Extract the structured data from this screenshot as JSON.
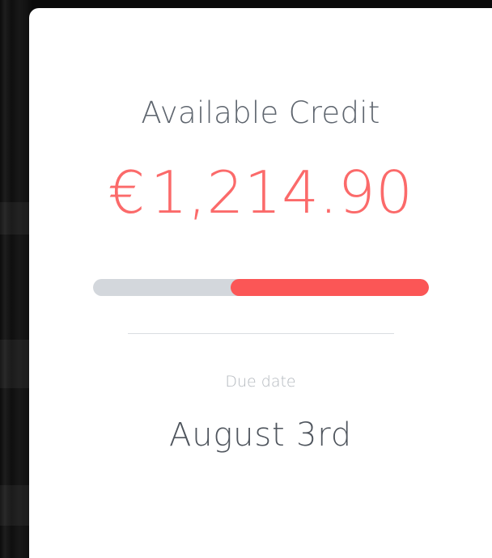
{
  "card": {
    "title": "Available Credit",
    "amount": {
      "currency_symbol": "€",
      "value": "1,214.90"
    },
    "progress": {
      "used_fraction": 0.59,
      "track_color": "#d3d7dc",
      "fill_color": "#fb5656"
    },
    "due": {
      "label": "Due date",
      "value": "August 3rd"
    }
  },
  "colors": {
    "accent": "#fb6a6a",
    "title_text": "#5e656e",
    "muted_text": "#b3b8be",
    "background": "#141414",
    "card": "#ffffff"
  }
}
